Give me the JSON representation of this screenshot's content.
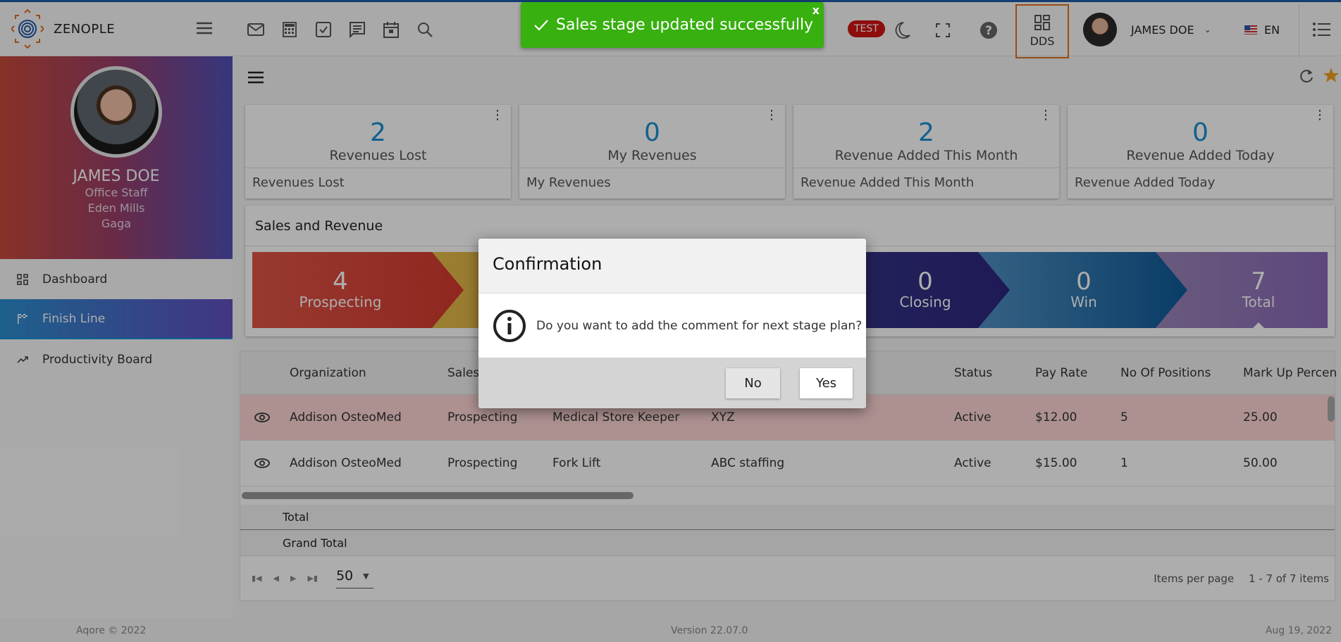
{
  "app": {
    "brand": "ZENOPLE",
    "env_badge": "TEST",
    "dds_label": "DDS",
    "user_name": "JAMES DOE",
    "language": "EN",
    "accent_color": "#1e5aa8",
    "dds_border_color": "#e07020"
  },
  "toolbar_icons": [
    "mail-icon",
    "calculator-icon",
    "checkbox-icon",
    "chat-icon",
    "calendar-icon",
    "search-icon"
  ],
  "toast": {
    "message": "Sales stage updated successfully",
    "close_label": "x",
    "color": "#38b010"
  },
  "profile": {
    "name": "JAMES DOE",
    "role": "Office Staff",
    "location": "Eden Mills",
    "org": "Gaga"
  },
  "sidebar": {
    "items": [
      {
        "label": "Dashboard",
        "icon": "dashboard-icon",
        "active": false
      },
      {
        "label": "Finish Line",
        "icon": "flag-icon",
        "active": true
      },
      {
        "label": "Productivity Board",
        "icon": "trending-icon",
        "active": false
      }
    ]
  },
  "cards": [
    {
      "value": "2",
      "title": "Revenues Lost",
      "footer": "Revenues Lost"
    },
    {
      "value": "0",
      "title": "My Revenues",
      "footer": "My Revenues"
    },
    {
      "value": "2",
      "title": "Revenue Added This Month",
      "footer": "Revenue Added This Month"
    },
    {
      "value": "0",
      "title": "Revenue Added Today",
      "footer": "Revenue Added Today"
    }
  ],
  "sales": {
    "title": "Sales and Revenue",
    "stages": [
      {
        "count": "4",
        "label": "Prospecting",
        "color1": "#e05548",
        "color2": "#d43a2e"
      },
      {
        "count": "",
        "label": "",
        "color1": "#e8c050",
        "color2": "#d4a030"
      },
      {
        "count": "",
        "label": "",
        "color1": "#3a3a80",
        "color2": "#2a2a78"
      },
      {
        "count": "0",
        "label": "Closing",
        "color1": "#3a3a88",
        "color2": "#2d2780"
      },
      {
        "count": "0",
        "label": "Win",
        "color1": "#5a98c8",
        "color2": "#0e5a98"
      },
      {
        "count": "7",
        "label": "Total",
        "color1": "#9e8ab8",
        "color2": "#8a6ab8"
      }
    ]
  },
  "table": {
    "columns": [
      "",
      "Organization",
      "Sales",
      "",
      "",
      "Status",
      "Pay Rate",
      "No Of Positions",
      "Mark Up Percen"
    ],
    "rows": [
      {
        "organization": "Addison OsteoMed",
        "stage": "Prospecting",
        "position": "Medical Store Keeper",
        "vendor": "XYZ",
        "status": "Active",
        "pay_rate": "$12.00",
        "positions": "5",
        "markup": "25.00",
        "highlighted": true
      },
      {
        "organization": "Addison OsteoMed",
        "stage": "Prospecting",
        "position": "Fork Lift",
        "vendor": "ABC staffing",
        "status": "Active",
        "pay_rate": "$15.00",
        "positions": "1",
        "markup": "50.00",
        "highlighted": false
      }
    ],
    "total_label": "Total",
    "grand_total_label": "Grand Total"
  },
  "pager": {
    "page_size": "50",
    "items_per_page_label": "Items per page",
    "range": "1 - 7 of 7 items"
  },
  "footer": {
    "copyright": "Aqore © 2022",
    "version": "Version 22.07.0",
    "date": "Aug 19, 2022"
  },
  "dialog": {
    "title": "Confirmation",
    "message": "Do you want to add the comment for next stage plan?",
    "no_label": "No",
    "yes_label": "Yes"
  }
}
